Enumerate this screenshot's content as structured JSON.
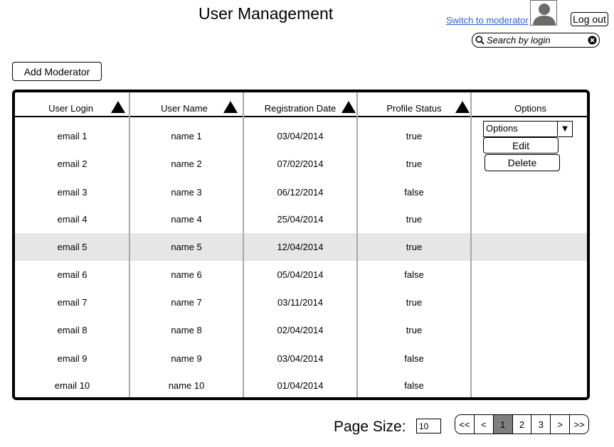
{
  "header": {
    "title": "User Management",
    "switch_link": "Switch to moderator",
    "logout_label": "Log out",
    "search_placeholder": "Search by login"
  },
  "toolbar": {
    "add_moderator_label": "Add Moderator"
  },
  "table": {
    "columns": [
      "User Login",
      "User Name",
      "Registration Date",
      "Profile Status",
      "Options"
    ],
    "rows": [
      [
        "email 1",
        "name 1",
        "03/04/2014",
        "true"
      ],
      [
        "email 2",
        "name 2",
        "07/02/2014",
        "true"
      ],
      [
        "email 3",
        "name 3",
        "06/12/2014",
        "false"
      ],
      [
        "email 4",
        "name 4",
        "25/04/2014",
        "true"
      ],
      [
        "email 5",
        "name 5",
        "12/04/2014",
        "true"
      ],
      [
        "email 6",
        "name 6",
        "05/04/2014",
        "false"
      ],
      [
        "email 7",
        "name 7",
        "03/11/2014",
        "true"
      ],
      [
        "email 8",
        "name 8",
        "02/04/2014",
        "true"
      ],
      [
        "email 9",
        "name 9",
        "03/04/2014",
        "false"
      ],
      [
        "email 10",
        "name 10",
        "01/04/2014",
        "false"
      ]
    ],
    "highlighted_row": 5,
    "options": {
      "select_value": "Options",
      "edit_label": "Edit",
      "delete_label": "Delete"
    },
    "sort_icons": [
      "sort-up-icon",
      "sort-up-icon",
      "sort-up-icon",
      "sort-up-icon"
    ]
  },
  "footer": {
    "page_size_label": "Page Size:",
    "page_size_value": "10",
    "pagination": [
      "<<",
      "<",
      "1",
      "2",
      "3",
      ">",
      ">>"
    ],
    "current_page": "1"
  },
  "colors": {
    "link": "#2b5fd9",
    "row_highlight": "#e6e6e6",
    "active_page": "#7f7f7f",
    "divider": "#a9a9a9"
  }
}
